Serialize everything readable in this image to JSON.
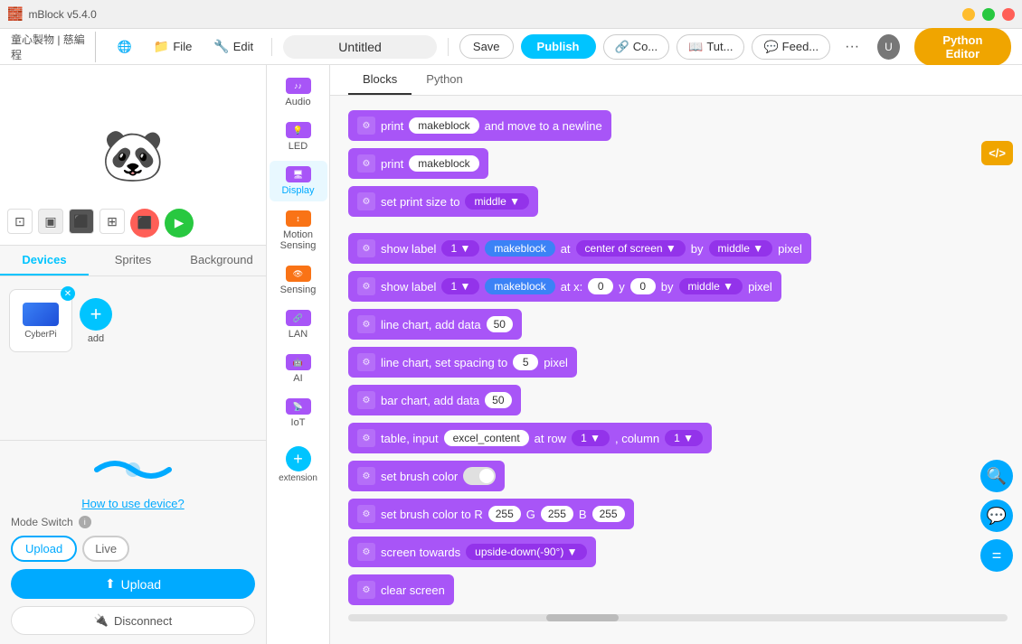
{
  "app": {
    "title": "mBlock v5.4.0",
    "window_controls": [
      "minimize",
      "maximize",
      "close"
    ]
  },
  "menubar": {
    "logo": "童心製物 | 慈編程",
    "globe_icon": "🌐",
    "file_label": "File",
    "edit_label": "Edit",
    "title_placeholder": "Untitled",
    "save_label": "Save",
    "publish_label": "Publish",
    "connect_label": "Co...",
    "tutorial_label": "Tut...",
    "feedback_label": "Feed...",
    "more_label": "···",
    "python_editor_label": "Python Editor"
  },
  "stage": {
    "panda_emoji": "🐼"
  },
  "tabs": {
    "devices_label": "Devices",
    "sprites_label": "Sprites",
    "background_label": "Background"
  },
  "device": {
    "name": "CyberPi",
    "upload_link": "How to use device?",
    "mode_switch_label": "Mode Switch",
    "upload_btn": "Upload",
    "live_btn": "Live",
    "upload_full_btn": "Upload",
    "disconnect_btn": "Disconnect",
    "add_label": "add"
  },
  "categories": [
    {
      "id": "audio",
      "label": "Audio",
      "color": "audio"
    },
    {
      "id": "led",
      "label": "LED",
      "color": "led"
    },
    {
      "id": "display",
      "label": "Display",
      "color": "display",
      "active": true
    },
    {
      "id": "motion",
      "label": "Motion Sensing",
      "color": "motion"
    },
    {
      "id": "sensing",
      "label": "Sensing",
      "color": "sensing"
    },
    {
      "id": "lan",
      "label": "LAN",
      "color": "lan"
    },
    {
      "id": "ai",
      "label": "AI",
      "color": "ai"
    },
    {
      "id": "iot",
      "label": "IoT",
      "color": "iot"
    }
  ],
  "extension_label": "extension",
  "blocks_tabs": {
    "blocks_label": "Blocks",
    "python_label": "Python"
  },
  "blocks": [
    {
      "id": "b1",
      "type": "print_newline",
      "text": "print",
      "pill": "makeblock",
      "suffix": "and move to a newline"
    },
    {
      "id": "b2",
      "type": "print",
      "text": "print",
      "pill": "makeblock"
    },
    {
      "id": "b3",
      "type": "set_print_size",
      "text": "set print size to",
      "dropdown": "middle ▼"
    },
    {
      "id": "b4",
      "type": "show_label_center",
      "text": "show label",
      "num1": "1 ▼",
      "pill": "makeblock",
      "suffix1": "at",
      "dropdown1": "center of screen ▼",
      "suffix2": "by",
      "dropdown2": "middle ▼",
      "suffix3": "pixel"
    },
    {
      "id": "b5",
      "type": "show_label_xy",
      "text": "show label",
      "num1": "1 ▼",
      "pill": "makeblock",
      "suffix1": "at x:",
      "x_val": "0",
      "suffix2": "y",
      "y_val": "0",
      "suffix3": "by",
      "dropdown": "middle ▼",
      "suffix4": "pixel"
    },
    {
      "id": "b6",
      "type": "line_chart_add",
      "text": "line chart, add data",
      "num": "50"
    },
    {
      "id": "b7",
      "type": "line_chart_spacing",
      "text": "line chart, set spacing to",
      "num": "5",
      "suffix": "pixel"
    },
    {
      "id": "b8",
      "type": "bar_chart_add",
      "text": "bar chart, add data",
      "num": "50"
    },
    {
      "id": "b9",
      "type": "table_input",
      "text": "table, input",
      "pill": "excel_content",
      "suffix1": "at row",
      "row": "1 ▼",
      "suffix2": ", column",
      "col": "1 ▼"
    },
    {
      "id": "b10",
      "type": "set_brush_color",
      "text": "set brush color"
    },
    {
      "id": "b11",
      "type": "set_brush_color_rgb",
      "text": "set brush color to R",
      "r": "255",
      "g_label": "G",
      "g": "255",
      "b_label": "B",
      "b": "255"
    },
    {
      "id": "b12",
      "type": "screen_towards",
      "text": "screen towards",
      "dropdown": "upside-down(-90°) ▼"
    },
    {
      "id": "b13",
      "type": "clear_screen",
      "text": "clear screen"
    }
  ],
  "zoom_controls": {
    "search_icon": "🔍",
    "chat_icon": "💬",
    "equals_icon": "="
  }
}
